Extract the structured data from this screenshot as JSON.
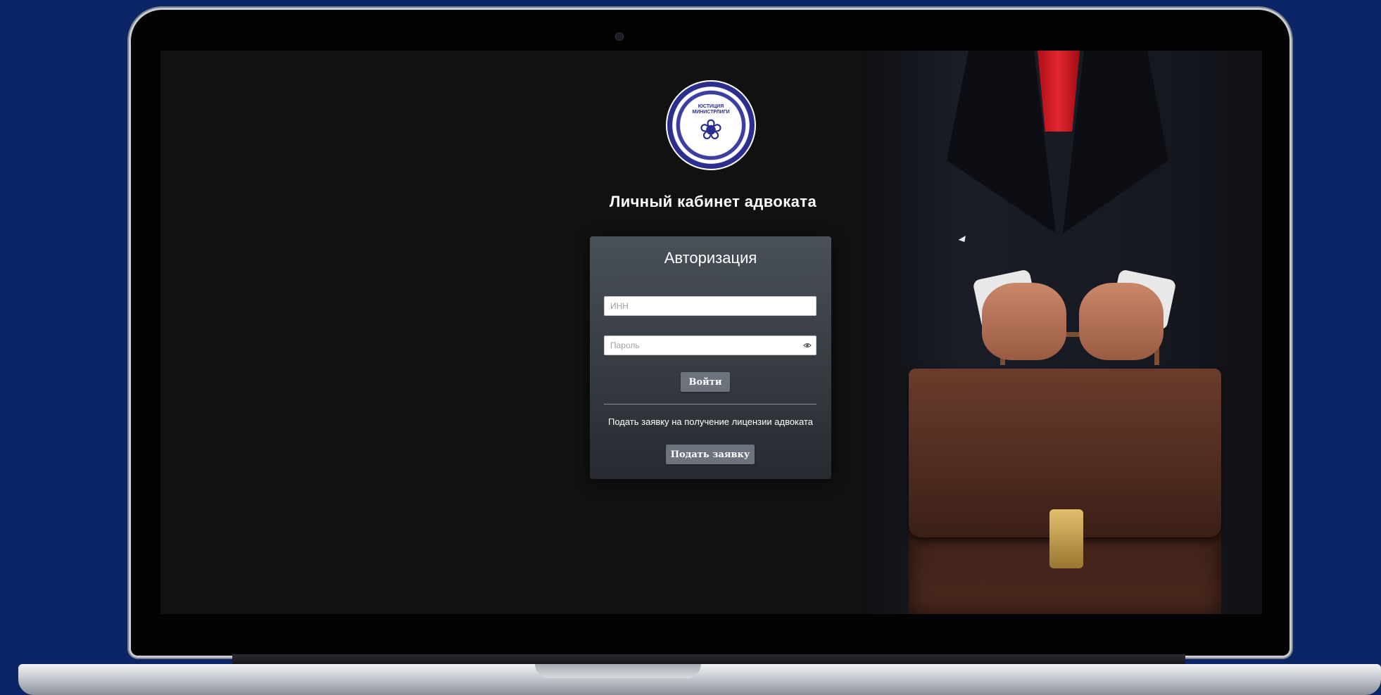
{
  "page": {
    "heading": "Личный кабинет адвоката"
  },
  "logo": {
    "icon": "ministry-of-justice-seal",
    "text": "ЮСТИЦИЯ МИНИСТРЛИГИ"
  },
  "auth": {
    "title": "Авторизация",
    "inn_placeholder": "ИНН",
    "password_placeholder": "Пароль",
    "password_toggle_icon": "eye-icon",
    "login_label": "Войти",
    "apply_text": "Подать заявку на получение лицензии адвоката",
    "apply_label": "Подать заявку"
  },
  "colors": {
    "background": "#0b2566",
    "screen": "#111111",
    "card": "#3a3f46",
    "button": "#6c737c"
  }
}
